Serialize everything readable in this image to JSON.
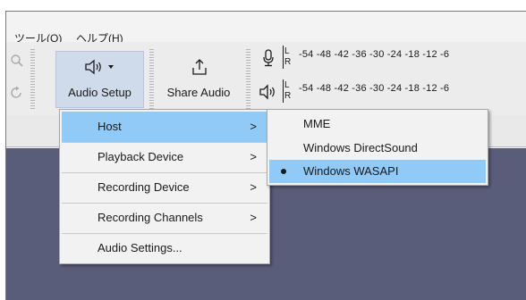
{
  "menubar": {
    "items": [
      {
        "label": "ツール(O)"
      },
      {
        "label": "ヘルプ(H)"
      }
    ]
  },
  "toolbar": {
    "audio_setup_label": "Audio Setup",
    "share_audio_label": "Share Audio"
  },
  "meters": {
    "record_l": "L",
    "record_r": "R",
    "play_l": "L",
    "play_r": "R",
    "ticks": "-54  -48  -42  -36  -30  -24  -18  -12  -6"
  },
  "audio_setup_menu": {
    "items": [
      {
        "label": "Host",
        "submenu": true,
        "highlighted": true
      },
      {
        "label": "Playback Device",
        "submenu": true
      },
      {
        "label": "Recording Device",
        "submenu": true
      },
      {
        "label": "Recording Channels",
        "submenu": true
      },
      {
        "label": "Audio Settings...",
        "submenu": false
      }
    ],
    "arrow_glyph": ">"
  },
  "host_submenu": {
    "items": [
      {
        "label": "MME",
        "selected": false
      },
      {
        "label": "Windows DirectSound",
        "selected": false
      },
      {
        "label": "Windows WASAPI",
        "selected": true
      }
    ]
  },
  "colors": {
    "menu_highlight": "#91c9f7",
    "button_active": "#cfdaea",
    "track_background": "#5a5d7a"
  }
}
